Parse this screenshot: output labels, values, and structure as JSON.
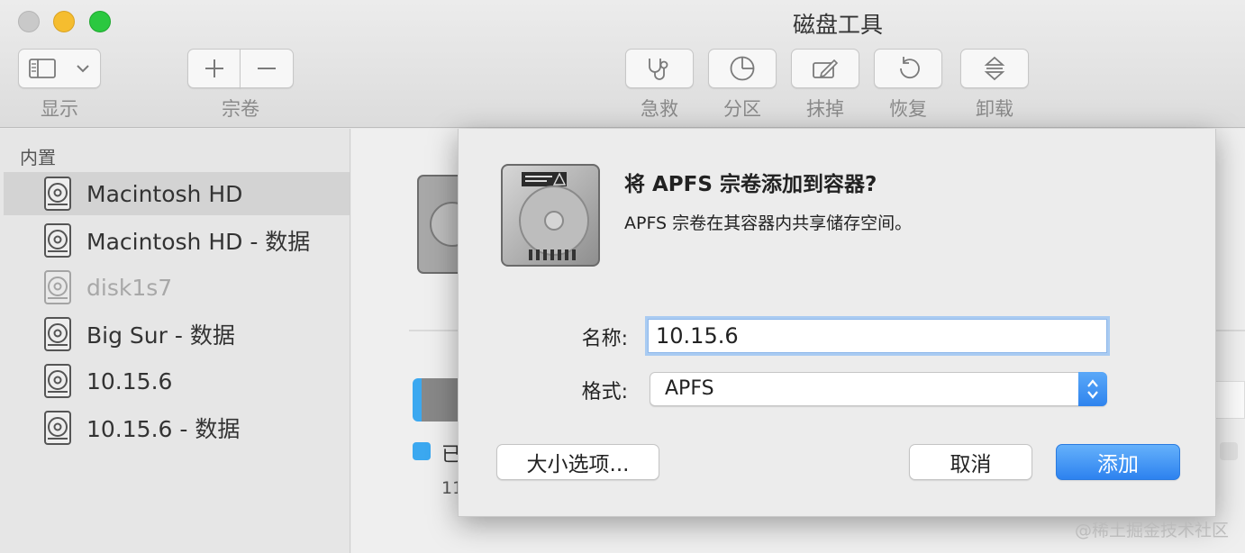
{
  "window": {
    "title": "磁盘工具"
  },
  "toolbar": {
    "view_label": "显示",
    "volume_label": "宗卷",
    "firstaid_label": "急救",
    "partition_label": "分区",
    "erase_label": "抹掉",
    "restore_label": "恢复",
    "unmount_label": "卸载"
  },
  "sidebar": {
    "section": "内置",
    "items": [
      {
        "label": "Macintosh HD"
      },
      {
        "label": "Macintosh HD - 数据"
      },
      {
        "label": "disk1s7"
      },
      {
        "label": "Big Sur - 数据"
      },
      {
        "label": "10.15.6"
      },
      {
        "label": "10.15.6 - 数据"
      }
    ]
  },
  "background": {
    "legend_partial": "已",
    "size_partial": "11"
  },
  "dialog": {
    "title": "将 APFS 宗卷添加到容器?",
    "subtitle": "APFS 宗卷在其容器内共享储存空间。",
    "name_label": "名称:",
    "name_value": "10.15.6",
    "format_label": "格式:",
    "format_value": "APFS",
    "size_options_button": "大小选项...",
    "cancel_button": "取消",
    "add_button": "添加"
  },
  "watermark": "@稀土掘金技术社区",
  "colors": {
    "accent": "#3b8ef0",
    "close": "#c9c9c9",
    "minimize": "#f5bd2f",
    "maximize": "#2bc840"
  }
}
